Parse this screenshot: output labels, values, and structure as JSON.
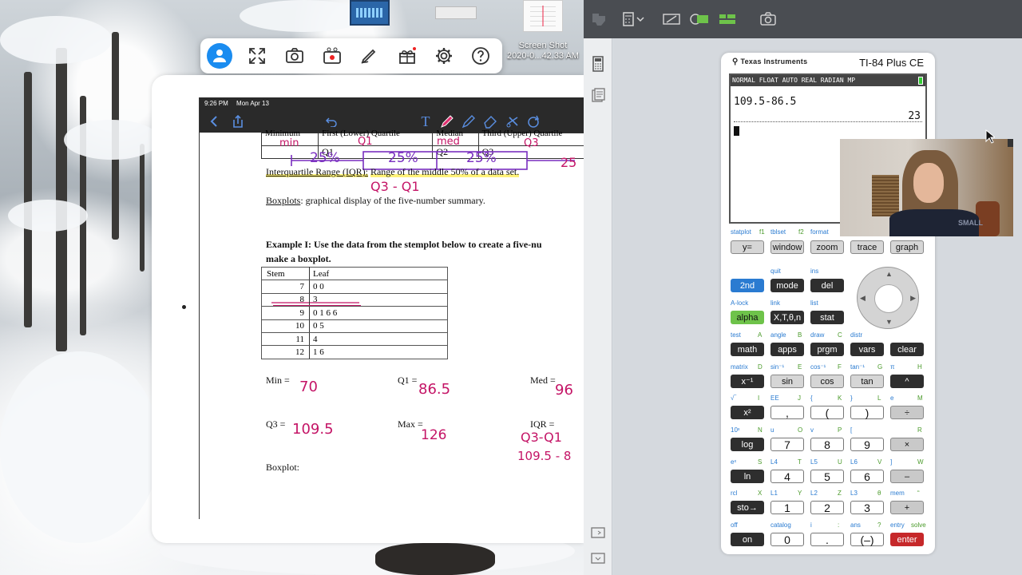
{
  "desktop": {
    "icon_screenshot_label": "Screen Shot\n2020-0...42.33 AM"
  },
  "floating_toolbar": {
    "icons": [
      "user-icon",
      "fullscreen-icon",
      "camera-icon",
      "record-icon",
      "pen-icon",
      "gift-icon",
      "gear-icon",
      "help-icon"
    ]
  },
  "ipad": {
    "status_time": "9:26 PM",
    "status_date": "Mon Apr 13",
    "toolbar_icons": [
      "back-icon",
      "share-icon",
      "undo-icon",
      "text-tool-icon",
      "pen-tool-icon",
      "highlighter-icon",
      "eraser-icon",
      "lasso-icon",
      "redo-icon"
    ]
  },
  "document": {
    "table_header_row": [
      "Minimum",
      "First (Lower) Quartile",
      "Median",
      "Third (Upper) Quartile"
    ],
    "table_row2": [
      "",
      "Q1",
      "Q2",
      "Q3"
    ],
    "iqr_text_term": "Interquartile Range (IQR):",
    "iqr_text_def": "Range of the middle 50% of a data set.",
    "boxplot_term": "Boxplots",
    "boxplot_def": ": graphical display of the five-number summary.",
    "example_line1": "Example I:  Use the data from the stemplot below to create a five-nu",
    "example_line2": "make a boxplot.",
    "stem_header": "Stem",
    "leaf_header": "Leaf",
    "stemplot": [
      {
        "stem": "7",
        "leaf": "0 0"
      },
      {
        "stem": "8",
        "leaf": "3"
      },
      {
        "stem": "9",
        "leaf": "0 1 6 6"
      },
      {
        "stem": "10",
        "leaf": "0 5"
      },
      {
        "stem": "11",
        "leaf": "4"
      },
      {
        "stem": "12",
        "leaf": "1 6"
      }
    ],
    "min_label": "Min =",
    "q1_label": "Q1 =",
    "med_label": "Med =",
    "q3_label": "Q3 =",
    "max_label": "Max =",
    "iqr_label": "IQR =",
    "boxplot_label": "Boxplot:"
  },
  "handwriting": {
    "min": "min",
    "q1": "Q1",
    "med": "med",
    "q3": "Q3",
    "pct1": "25%",
    "pct2": "25%",
    "pct3": "25%",
    "pct4": "25",
    "iqr_formula": "Q3 - Q1",
    "min_val": "70",
    "q1_val": "86.5",
    "med_val": "96",
    "q3_val": "109.5",
    "max_val": "126",
    "iqr_formula2": "Q3-Q1",
    "iqr_calc": "109.5 - 8"
  },
  "calculator": {
    "brand": "Texas Instruments",
    "model": "TI-84 Plus CE",
    "status": "NORMAL FLOAT AUTO REAL RADIAN MP",
    "entry": "109.5-86.5",
    "result": "23",
    "keys": {
      "y_eq": "y=",
      "window": "window",
      "zoom": "zoom",
      "trace": "trace",
      "graph": "graph",
      "second": "2nd",
      "mode": "mode",
      "del": "del",
      "alpha": "alpha",
      "xton": "X,T,θ,n",
      "stat": "stat",
      "math": "math",
      "apps": "apps",
      "prgm": "prgm",
      "vars": "vars",
      "clear": "clear",
      "xinv": "x⁻¹",
      "sin": "sin",
      "cos": "cos",
      "tan": "tan",
      "caret": "^",
      "x2": "x²",
      "comma": ",",
      "lparen": "(",
      "rparen": ")",
      "div": "÷",
      "log": "log",
      "k7": "7",
      "k8": "8",
      "k9": "9",
      "mul": "×",
      "ln": "ln",
      "k4": "4",
      "k5": "5",
      "k6": "6",
      "minus": "–",
      "sto": "sto→",
      "k1": "1",
      "k2": "2",
      "k3": "3",
      "plus": "+",
      "on": "on",
      "k0": "0",
      "dot": ".",
      "neg": "(–)",
      "enter": "enter"
    },
    "labels": {
      "statplot": "statplot",
      "f1": "f1",
      "tblset": "tblset",
      "f2": "f2",
      "format": "format",
      "quit": "quit",
      "ins": "ins",
      "alock": "A-lock",
      "link": "link",
      "list": "list",
      "test": "test",
      "A": "A",
      "angle": "angle",
      "B": "B",
      "draw": "draw",
      "C": "C",
      "distr": "distr",
      "matrix": "matrix",
      "D": "D",
      "sininv": "sin⁻¹",
      "E": "E",
      "cosinv": "cos⁻¹",
      "F": "F",
      "taninv": "tan⁻¹",
      "G": "G",
      "pi": "π",
      "H": "H",
      "sqrt": "√‾",
      "I": "I",
      "EE": "EE",
      "J": "J",
      "lbrace": "{",
      "K": "K",
      "rbrace": "}",
      "L": "L",
      "e": "e",
      "M": "M",
      "tenx": "10ˣ",
      "N": "N",
      "u": "u",
      "O": "O",
      "v": "v",
      "P": "P",
      "lbr": "[",
      "R": "R",
      "ex": "eˣ",
      "S": "S",
      "L4": "L4",
      "T": "T",
      "L5": "L5",
      "U": "U",
      "L6": "L6",
      "V": "V",
      "rbr": "]",
      "W": "W",
      "rcl": "rcl",
      "X": "X",
      "L1": "L1",
      "Y": "Y",
      "L2": "L2",
      "Z": "Z",
      "L3": "L3",
      "theta": "θ",
      "mem": "mem",
      "quote": "“",
      "off": "off",
      "catalog": "catalog",
      "i": "i",
      "colon": ":",
      "ans": "ans",
      "q": "?",
      "entry": "entry",
      "solve": "solve"
    }
  },
  "webcam": {
    "shirt_text": "SMALL"
  },
  "colors": {
    "handwriting_magenta": "#c41466",
    "handwriting_purple": "#7a2fc0",
    "calc_blue": "#2a7bd1",
    "calc_green": "#6ec34a",
    "calc_red": "#c6282a"
  }
}
